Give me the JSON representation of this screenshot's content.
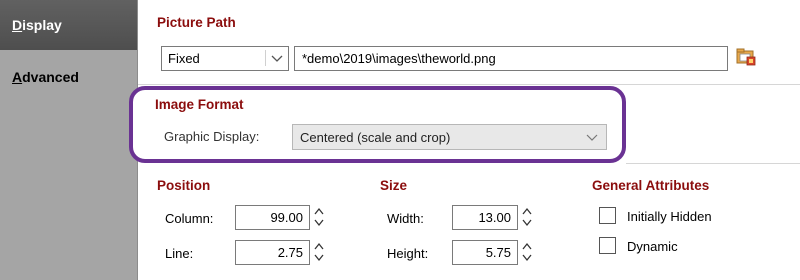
{
  "sidebar": {
    "tabs": [
      {
        "label_u": "D",
        "label_rest": "isplay"
      },
      {
        "label_u": "A",
        "label_rest": "dvanced"
      }
    ]
  },
  "picture_path": {
    "title": "Picture Path",
    "mode": "Fixed",
    "path": "*demo\\2019\\images\\theworld.png"
  },
  "image_format": {
    "title": "Image Format",
    "graphic_display_label": "Graphic Display:",
    "graphic_display_value": "Centered (scale and crop)"
  },
  "position": {
    "title": "Position",
    "column_label": "Column:",
    "column_value": "99.00",
    "line_label": "Line:",
    "line_value": "2.75"
  },
  "size": {
    "title": "Size",
    "width_label": "Width:",
    "width_value": "13.00",
    "height_label": "Height:",
    "height_value": "5.75"
  },
  "general_attributes": {
    "title": "General Attributes",
    "initially_hidden_label": "Initially Hidden",
    "initially_hidden_checked": false,
    "dynamic_label": "Dynamic",
    "dynamic_checked": false
  },
  "colors": {
    "section_title": "#8b0d0d",
    "highlight_border": "#6a3293",
    "active_tab": "#575757",
    "sidebar": "#a5a5a5"
  }
}
